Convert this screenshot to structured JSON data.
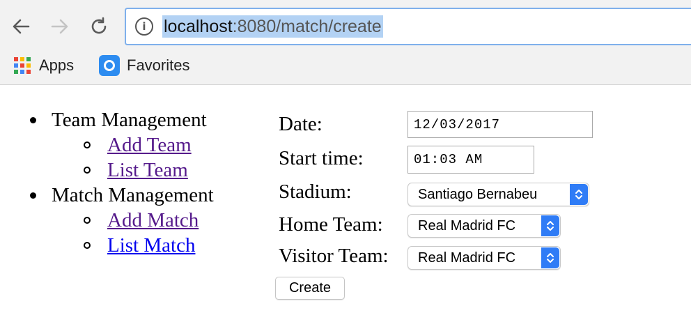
{
  "browser": {
    "url_host": "localhost",
    "url_rest": ":8080/match/create",
    "bookmarks": [
      {
        "label": "Apps",
        "icon": "apps-grid-icon"
      },
      {
        "label": "Favorites",
        "icon": "favorites-icon"
      }
    ],
    "apps_colors": [
      "#ea4335",
      "#fbbc05",
      "#34a853",
      "#4285f4",
      "#ea4335",
      "#fbbc05",
      "#34a853",
      "#4285f4",
      "#ea4335"
    ]
  },
  "sidebar": {
    "sections": [
      {
        "title": "Team Management",
        "links": [
          "Add Team",
          "List Team"
        ]
      },
      {
        "title": "Match Management",
        "links": [
          "Add Match",
          "List Match"
        ]
      }
    ]
  },
  "form": {
    "date_label": "Date:",
    "date_value": "12/03/2017",
    "start_time_label": "Start time:",
    "start_time_value": "01:03 AM",
    "stadium_label": "Stadium:",
    "stadium_value": "Santiago Bernabeu",
    "home_team_label": "Home Team:",
    "home_team_value": "Real Madrid FC",
    "visitor_team_label": "Visitor Team:",
    "visitor_team_value": "Real Madrid FC",
    "submit_label": "Create"
  },
  "colors": {
    "visited_link": "#551a8b",
    "unvisited_link": "#0000ee",
    "select_accent": "#2f7cf6",
    "url_highlight": "#b3d2f4"
  }
}
